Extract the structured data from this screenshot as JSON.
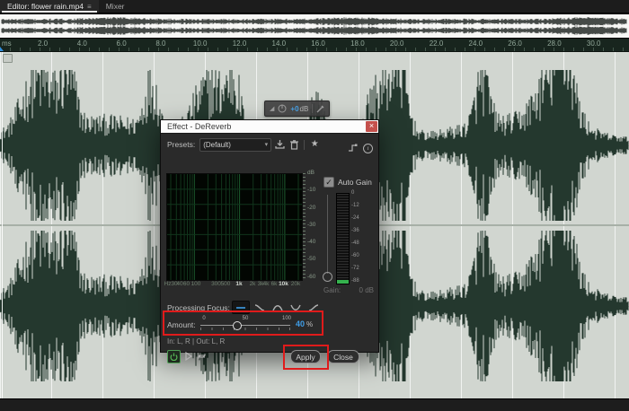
{
  "icons": {
    "menu": "≡",
    "caret": "▾",
    "star": "★",
    "check": "✓",
    "close": "×",
    "info": "i",
    "hud_fader": "◢"
  },
  "window": {
    "tabs": [
      {
        "label": "Editor: flower rain.mp4",
        "active": true
      },
      {
        "label": "Mixer",
        "active": false
      }
    ]
  },
  "ruler": {
    "unit_label": "ms",
    "labels": [
      "2.0",
      "4.0",
      "6.0",
      "8.0",
      "10.0",
      "12.0",
      "14.0",
      "16.0",
      "18.0",
      "20.0",
      "22.0",
      "24.0",
      "26.0",
      "28.0",
      "30.0"
    ]
  },
  "hud": {
    "volume_value": "+0",
    "volume_unit": "dB"
  },
  "dialog": {
    "title": "Effect - DeReverb",
    "presets": {
      "label": "Presets:",
      "value": "(Default)"
    },
    "graph": {
      "db_axis": [
        "dB",
        "-10",
        "-20",
        "-30",
        "-40",
        "-50",
        "-60"
      ],
      "freq_axis": [
        "Hz",
        "30",
        "40",
        "60",
        "100",
        "300",
        "500",
        "1k",
        "2k",
        "3k",
        "4k",
        "6k",
        "10k",
        "20k"
      ],
      "freq_bright": [
        "1k",
        "10k"
      ]
    },
    "auto_gain": {
      "label": "Auto Gain",
      "checked": true
    },
    "meter_scale": [
      "0",
      "-12",
      "-24",
      "-36",
      "-48",
      "-60",
      "-72",
      "-88"
    ],
    "gain": {
      "label": "Gain:",
      "value": "0 dB"
    },
    "processing_focus": {
      "label": "Processing Focus:",
      "selected_index": 0
    },
    "amount": {
      "label": "Amount:",
      "scale": [
        "0",
        "50",
        "100"
      ],
      "value": "40",
      "unit": "%",
      "percent": 40
    },
    "io_text": "In: L, R | Out: L, R",
    "buttons": {
      "apply": "Apply",
      "close": "Close"
    }
  },
  "colors": {
    "accent_blue": "#3f9ee8",
    "annotation_red": "#e01b1b",
    "wave_green": "#24382e",
    "grid_green": "#11351c",
    "grid_green_major": "#1c5a2e"
  }
}
